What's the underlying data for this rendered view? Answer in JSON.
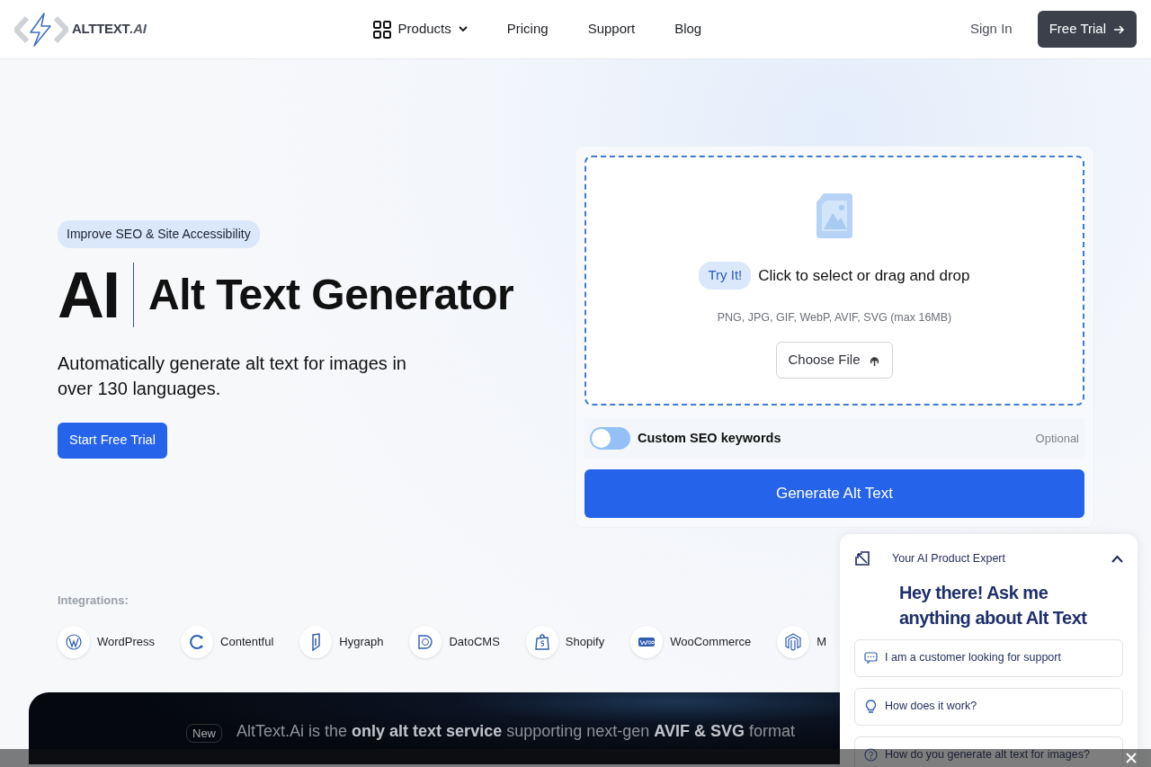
{
  "header": {
    "logo": "ALTTEXT",
    "logo_suffix": ".AI",
    "menu": [
      {
        "label": "Products",
        "kind": "dropdown"
      },
      {
        "label": "Pricing",
        "kind": "link"
      },
      {
        "label": "Support",
        "kind": "link"
      },
      {
        "label": "Blog",
        "kind": "link"
      }
    ],
    "sign_in": "Sign In",
    "free_trial": "Free Trial"
  },
  "hero": {
    "badge": "Improve SEO & Site Accessibility",
    "title_short": "AI",
    "title": "Alt Text Generator",
    "subtitle": "Automatically generate alt text for images in over 130 languages.",
    "cta": "Start Free Trial"
  },
  "uploader": {
    "try_badge": "Try It!",
    "prompt": "Click to select or drag and drop",
    "formats": "PNG, JPG, GIF, WebP, AVIF, SVG (max 16MB)",
    "choose_button": "Choose File",
    "seo_toggle": {
      "label": "Custom SEO keywords",
      "on": false,
      "hint": "Optional"
    },
    "generate_button": "Generate Alt Text"
  },
  "integrations": {
    "label": "Integrations:",
    "items": [
      {
        "name": "WordPress",
        "kind": "wordpress"
      },
      {
        "name": "Contentful",
        "kind": "contentful"
      },
      {
        "name": "Hygraph",
        "kind": "hygraph"
      },
      {
        "name": "DatoCMS",
        "kind": "datocms"
      },
      {
        "name": "Shopify",
        "kind": "shopify"
      },
      {
        "name": "WooCommerce",
        "kind": "woo"
      },
      {
        "name": "M",
        "kind": "magento"
      }
    ]
  },
  "banner": {
    "badge": "New",
    "text": "AltText.Ai is the **only alt text service** supporting next-gen **AVIF & SVG** format"
  },
  "chat": {
    "title": "Your AI Product Expert",
    "expanded": true,
    "heading": "Hey there! Ask me anything about Alt Text",
    "options": [
      {
        "label": "I am a customer looking for support",
        "kind": "chat"
      },
      {
        "label": "How does it work?",
        "kind": "bulb"
      },
      {
        "label": "How do you generate alt text for images?",
        "kind": "question"
      }
    ]
  }
}
